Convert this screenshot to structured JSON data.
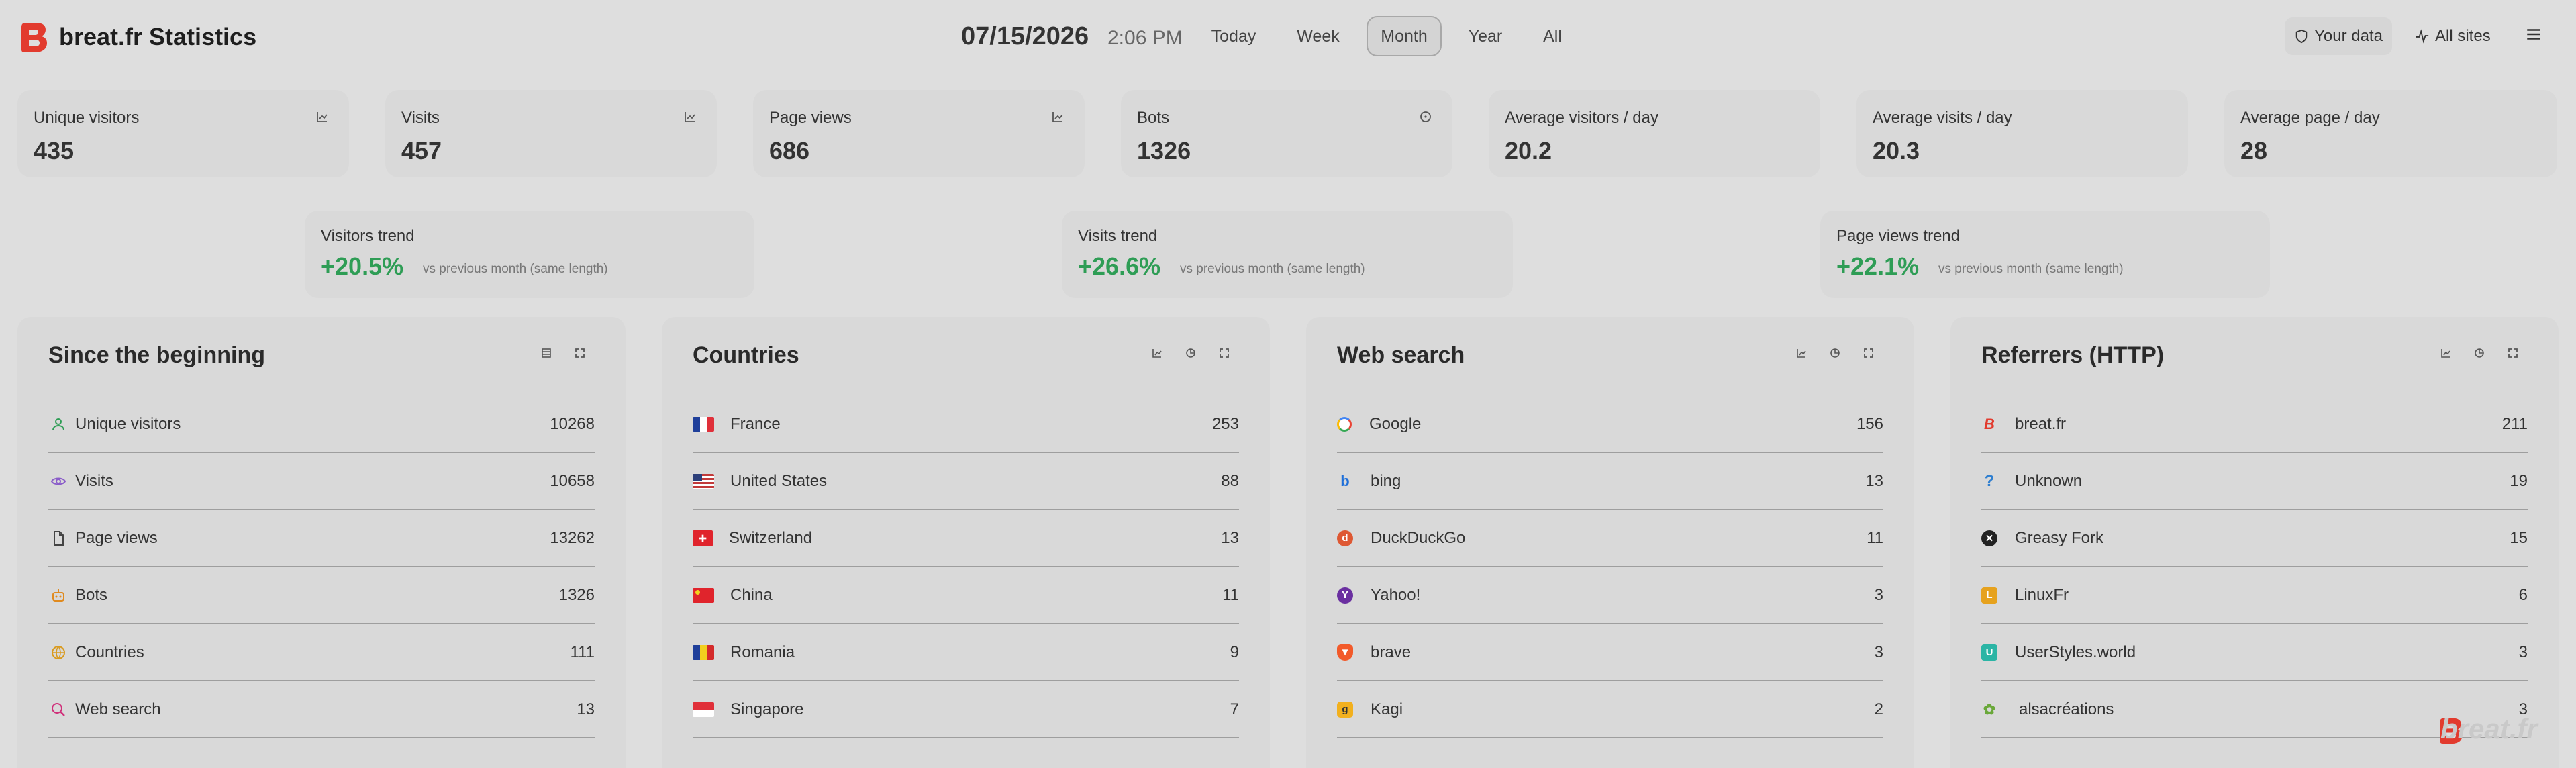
{
  "header": {
    "brand": "breat.fr Statistics",
    "date": "07/15/2026",
    "time": "2:06 PM",
    "periods": [
      "Today",
      "Week",
      "Month",
      "Year",
      "All"
    ],
    "active_period": "Month",
    "your_data": "Your data",
    "all_sites": "All sites"
  },
  "stats": [
    {
      "label": "Unique visitors",
      "value": "435",
      "icon": "chart-icon"
    },
    {
      "label": "Visits",
      "value": "457",
      "icon": "chart-icon"
    },
    {
      "label": "Page views",
      "value": "686",
      "icon": "chart-icon"
    },
    {
      "label": "Bots",
      "value": "1326",
      "icon": "info-icon"
    },
    {
      "label": "Average visitors / day",
      "value": "20.2"
    },
    {
      "label": "Average visits / day",
      "value": "20.3"
    },
    {
      "label": "Average page / day",
      "value": "28"
    }
  ],
  "trends": [
    {
      "label": "Visitors trend",
      "pct": "+20.5%",
      "cmp": "vs previous month (same length)"
    },
    {
      "label": "Visits trend",
      "pct": "+26.6%",
      "cmp": "vs previous month (same length)"
    },
    {
      "label": "Page views trend",
      "pct": "+22.1%",
      "cmp": "vs previous month (same length)"
    }
  ],
  "panels": {
    "since": {
      "title": "Since the beginning",
      "rows": [
        {
          "label": "Unique visitors",
          "value": "10268",
          "icon": "user-icon",
          "color": "#2e9d55"
        },
        {
          "label": "Visits",
          "value": "10658",
          "icon": "eye-icon",
          "color": "#8a5cc9"
        },
        {
          "label": "Page views",
          "value": "13262",
          "icon": "page-icon",
          "color": "#444444"
        },
        {
          "label": "Bots",
          "value": "1326",
          "icon": "bot-icon",
          "color": "#e08a1e"
        },
        {
          "label": "Countries",
          "value": "111",
          "icon": "globe-icon",
          "color": "#d99a1e"
        },
        {
          "label": "Web search",
          "value": "13",
          "icon": "search-icon",
          "color": "#d0307a"
        }
      ]
    },
    "countries": {
      "title": "Countries",
      "rows": [
        {
          "label": "France",
          "value": "253",
          "icon": "flag-fr-icon"
        },
        {
          "label": "United States",
          "value": "88",
          "icon": "flag-us-icon"
        },
        {
          "label": "Switzerland",
          "value": "13",
          "icon": "flag-ch-icon"
        },
        {
          "label": "China",
          "value": "11",
          "icon": "flag-cn-icon"
        },
        {
          "label": "Romania",
          "value": "9",
          "icon": "flag-ro-icon"
        },
        {
          "label": "Singapore",
          "value": "7",
          "icon": "flag-sg-icon"
        }
      ]
    },
    "search": {
      "title": "Web search",
      "rows": [
        {
          "label": "Google",
          "value": "156",
          "icon": "google-icon",
          "color": "#4285f4"
        },
        {
          "label": "bing",
          "value": "13",
          "icon": "bing-icon",
          "color": "#1e6fd9"
        },
        {
          "label": "DuckDuckGo",
          "value": "11",
          "icon": "duckduckgo-icon",
          "color": "#de5833"
        },
        {
          "label": "Yahoo!",
          "value": "3",
          "icon": "yahoo-icon",
          "color": "#6a2fa0"
        },
        {
          "label": "brave",
          "value": "3",
          "icon": "brave-icon",
          "color": "#f25a2a"
        },
        {
          "label": "Kagi",
          "value": "2",
          "icon": "kagi-icon",
          "color": "#f2b01e"
        }
      ]
    },
    "referrers": {
      "title": "Referrers (HTTP)",
      "rows": [
        {
          "label": "breat.fr",
          "value": "211",
          "icon": "breat-icon",
          "color": "#e23b2e"
        },
        {
          "label": "Unknown",
          "value": "19",
          "icon": "question-icon",
          "color": "#2f7fd0"
        },
        {
          "label": "Greasy Fork",
          "value": "15",
          "icon": "greasyfork-icon",
          "color": "#222222"
        },
        {
          "label": "LinuxFr",
          "value": "6",
          "icon": "linuxfr-icon",
          "color": "#e6a21e"
        },
        {
          "label": "UserStyles.world",
          "value": "3",
          "icon": "userstyles-icon",
          "color": "#2bb5a5"
        },
        {
          "label": "alsacréations",
          "value": "3",
          "icon": "alsacreations-icon",
          "color": "#6aa83a"
        }
      ]
    }
  },
  "watermark": "breat.fr"
}
